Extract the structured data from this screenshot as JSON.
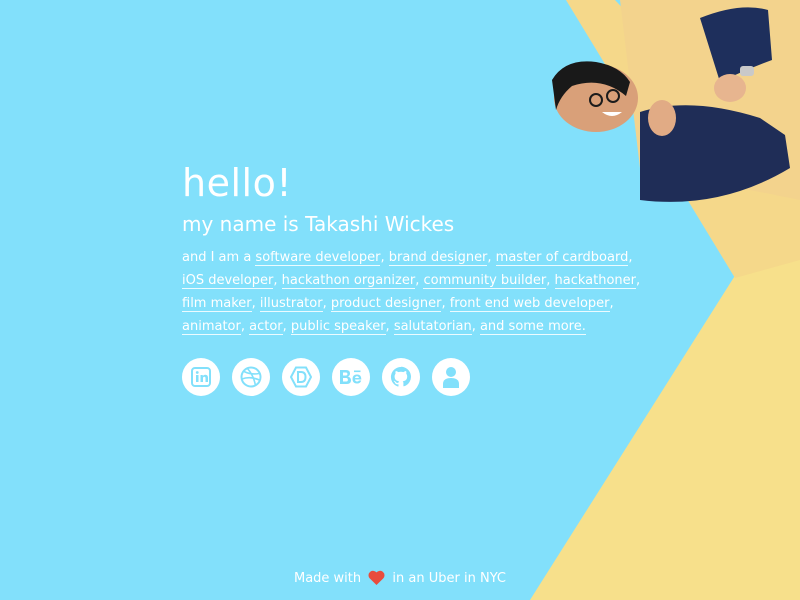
{
  "intro": {
    "greeting": "hello!",
    "name_line": "my name is Takashi Wickes",
    "roles_prefix": "and I am a "
  },
  "roles": [
    "software developer",
    "brand designer",
    "master of cardboard",
    "iOS developer",
    "hackathon organizer",
    "community builder",
    "hackathoner",
    "film maker",
    "illustrator",
    "product designer",
    "front end web developer",
    "animator",
    "actor",
    "public speaker",
    "salutatorian",
    "and some more."
  ],
  "social_icons": [
    "linkedin-icon",
    "dribbble-icon",
    "devpost-icon",
    "behance-icon",
    "github-icon",
    "user-icon"
  ],
  "footer": {
    "prefix": "Made with",
    "suffix": "in an Uber in NYC"
  },
  "colors": {
    "background": "#82e0fb",
    "accent_yellow": "#f7e08b",
    "icon_blue": "#82e0fb",
    "heart": "#e84c3d",
    "text": "#ffffff"
  }
}
